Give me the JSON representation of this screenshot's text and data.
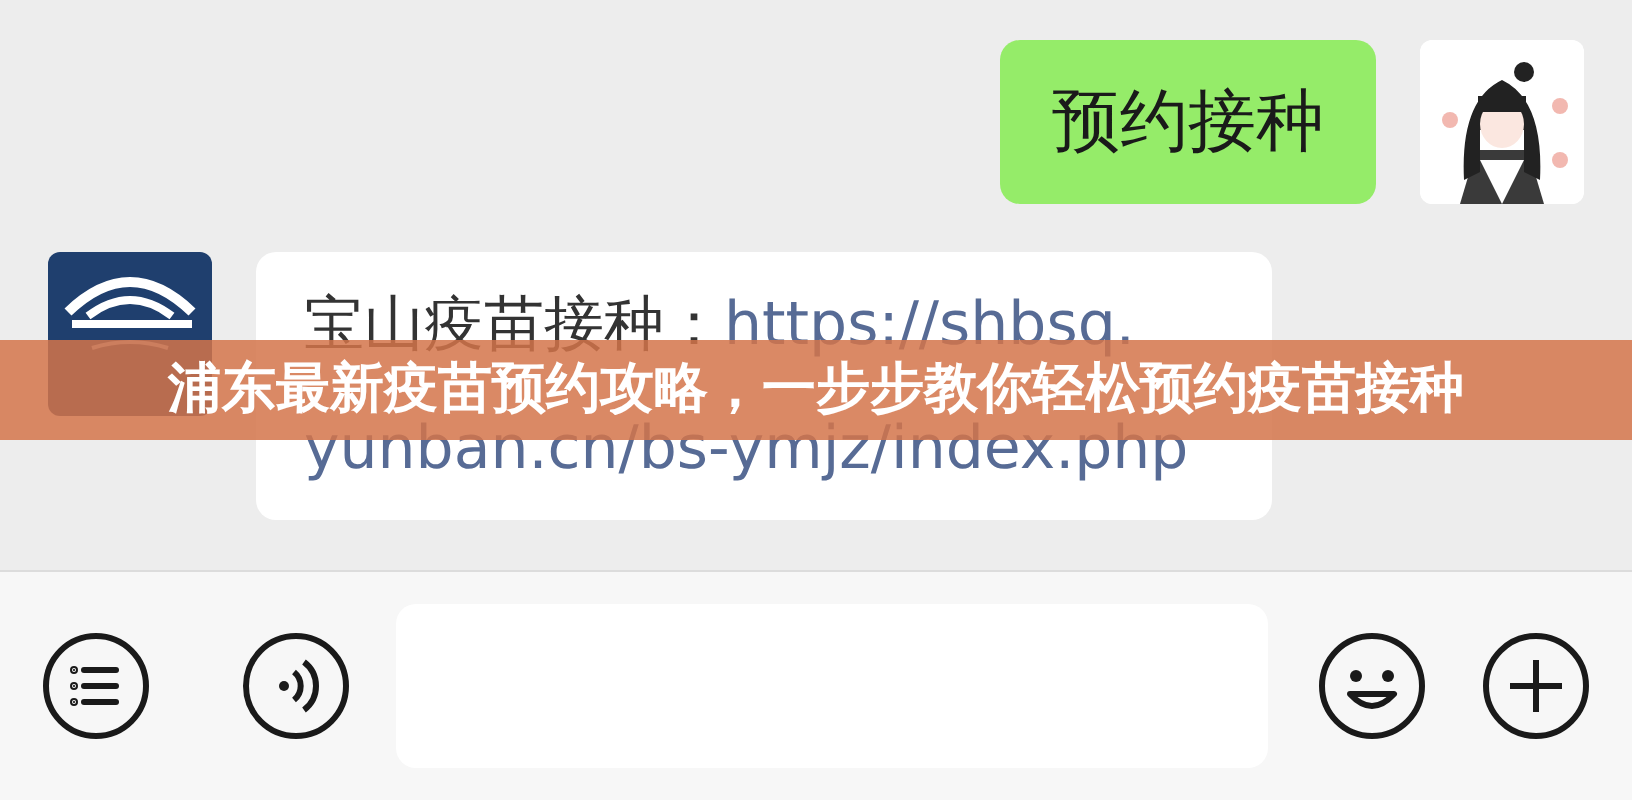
{
  "messages": [
    {
      "lines": [
        {
          "text": "预约接种",
          "kind": "plain"
        }
      ]
    },
    {
      "lines": [
        {
          "text": "宝山疫苗接种：",
          "kind": "plain"
        },
        {
          "text": "https://shbsq.",
          "kind": "link"
        },
        {
          "text": "yunban.cn/bs-ymjz/index.php",
          "kind": "link"
        }
      ]
    }
  ],
  "banner": {
    "text": "浦东最新疫苗预约攻略，一步步教你轻松预约疫苗接种"
  }
}
